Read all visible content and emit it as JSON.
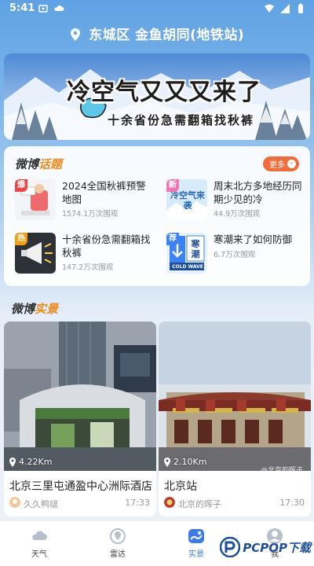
{
  "status_bar": {
    "time": "5:41"
  },
  "location": {
    "text": "东城区 金鱼胡同(地铁站)"
  },
  "banner": {
    "title": "冷空气又又又来了",
    "subtitle": "十余省份急需翻箱找秋裤"
  },
  "hot_topics": {
    "title_main": "微博",
    "title_accent": "话题",
    "more_label": "更多",
    "items": [
      {
        "tag": "爆",
        "tag_color": "#ef4444",
        "text": "2024全国秋裤预警地图",
        "views": "1574.1万次围观",
        "thumb_text": ""
      },
      {
        "tag": "新",
        "tag_color": "#f472b6",
        "text": "周末北方多地经历同期少见的冷",
        "views": "44.9万次围观",
        "thumb_text": "冷空气来袭"
      },
      {
        "tag": "热",
        "tag_color": "#f59e0b",
        "text": "十余省份急需翻箱找秋裤",
        "views": "147.2万次围观",
        "thumb_text": ""
      },
      {
        "tag": "荐",
        "tag_color": "#3b82f6",
        "text": "寒潮来了如何防御",
        "views": "6.7万次围观",
        "thumb_text": "寒潮",
        "thumb_sub": "COLD WAVE"
      }
    ]
  },
  "scenes": {
    "title_main": "微博",
    "title_accent": "实景",
    "items": [
      {
        "distance": "4.22Km",
        "name": "北京三里屯通盈中心洲际酒店",
        "user": "久久鸭啵",
        "time": "17:33"
      },
      {
        "distance": "2.10Km",
        "name": "北京站",
        "user": "北京的晖子",
        "time": "17:30",
        "watermark": "@北京的晖子"
      }
    ]
  },
  "nav": {
    "items": [
      {
        "label": "天气",
        "icon": "cloud-icon"
      },
      {
        "label": "雷达",
        "icon": "radar-icon"
      },
      {
        "label": "实景",
        "icon": "photo-icon",
        "active": true
      },
      {
        "label": "我",
        "icon": "profile-icon"
      }
    ]
  },
  "brand": {
    "text": "PCPOP下载"
  },
  "colors": {
    "accent": "#f08a1c",
    "active_nav": "#3d7be8",
    "more_button": "#f26b3a"
  }
}
